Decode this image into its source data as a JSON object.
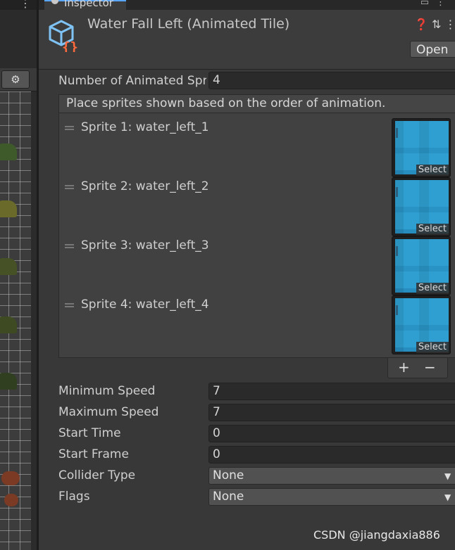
{
  "tab": {
    "title": "Inspector"
  },
  "header": {
    "asset_title": "Water Fall Left (Animated Tile)",
    "open_label": "Open"
  },
  "fields": {
    "num_sprites_label": "Number of Animated Spr",
    "num_sprites_value": "4",
    "list_header": "Place sprites shown based on the order of animation.",
    "sprites": [
      {
        "label": "Sprite 1: water_left_1",
        "select": "Select"
      },
      {
        "label": "Sprite 2: water_left_2",
        "select": "Select"
      },
      {
        "label": "Sprite 3: water_left_3",
        "select": "Select"
      },
      {
        "label": "Sprite 4: water_left_4",
        "select": "Select"
      }
    ],
    "add_label": "+",
    "remove_label": "−",
    "min_speed_label": "Minimum Speed",
    "min_speed_value": "7",
    "max_speed_label": "Maximum Speed",
    "max_speed_value": "7",
    "start_time_label": "Start Time",
    "start_time_value": "0",
    "start_frame_label": "Start Frame",
    "start_frame_value": "0",
    "collider_label": "Collider Type",
    "collider_value": "None",
    "flags_label": "Flags",
    "flags_value": "None"
  },
  "watermark": "CSDN @jiangdaxia886",
  "colors": {
    "accent": "#58a6ff",
    "sprite_water": "#2e9fd0",
    "icon_brace": "#ff6a3d",
    "icon_cube": "#7fc3f5"
  }
}
